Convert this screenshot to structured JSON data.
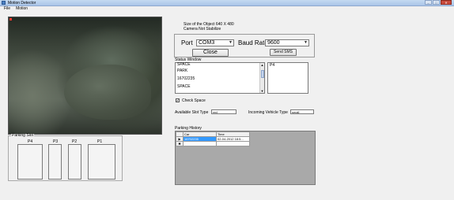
{
  "window": {
    "title": "Motion Detector",
    "controls": {
      "minimize": "–",
      "maximize": "□",
      "close": "✕"
    }
  },
  "menu": {
    "items": [
      "File",
      "Motion"
    ]
  },
  "camera": {
    "icon": "camera-feed"
  },
  "parking_slots": {
    "group_label": "Parking Slot",
    "slots": [
      "P4",
      "P3",
      "P2",
      "P1"
    ]
  },
  "object_info": {
    "size_text": "Size of the Object   640 X 480",
    "stabilize_text": "Camera Not Stabilize"
  },
  "port_panel": {
    "port_label": "Port",
    "port_value": "COM3",
    "baud_label": "Baud Rate",
    "baud_value": "9600",
    "close_button": "Close",
    "send_sms_button": "Send SMS"
  },
  "status_window": {
    "title": "Status Window",
    "items": [
      "SPACE",
      "PARK",
      "16702235",
      "SPACE"
    ],
    "side_value": "P4"
  },
  "check_space": {
    "label": "Check Space",
    "checked": true
  },
  "available_slot": {
    "label": "Available Slot Type",
    "value": "red"
  },
  "incoming_vehicle": {
    "label": "Incoming Vehicle Type",
    "value": "small"
  },
  "parking_history": {
    "title": "Parking History",
    "columns": [
      "Car",
      "Time"
    ],
    "rows": [
      {
        "marker": "▶",
        "car": "16702235",
        "time": "02-04-2012 18:5..."
      },
      {
        "marker": "✱",
        "car": "",
        "time": ""
      }
    ]
  }
}
